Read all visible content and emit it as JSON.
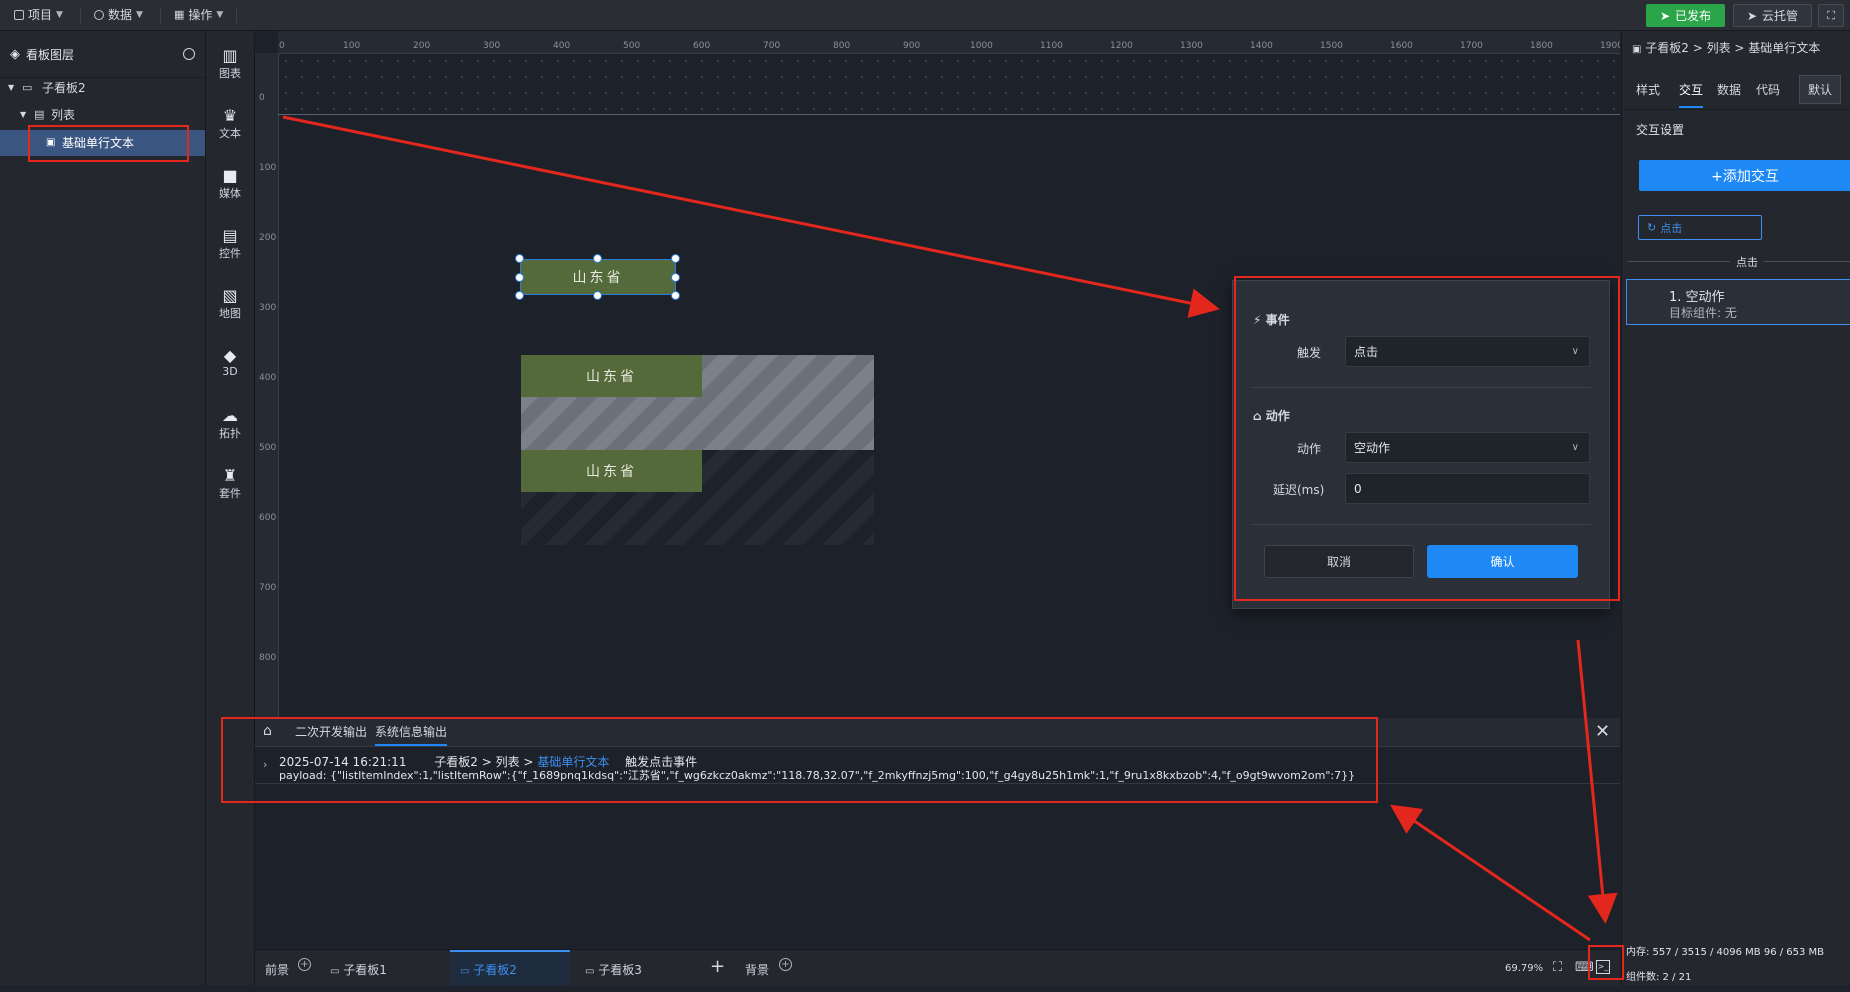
{
  "topbar": {
    "menus": [
      "项目",
      "数据",
      "操作"
    ],
    "published_label": "已发布",
    "cloud_label": "云托管"
  },
  "layers": {
    "title": "看板图层",
    "tree": [
      "子看板2",
      "列表",
      "基础单行文本"
    ]
  },
  "components": [
    "图表",
    "文本",
    "媒体",
    "控件",
    "地图",
    "3D",
    "拓扑",
    "套件"
  ],
  "ruler": {
    "top": [
      "0",
      "100",
      "200",
      "300",
      "400",
      "500",
      "600",
      "700",
      "800",
      "900",
      "1000",
      "1100",
      "1200",
      "1300",
      "1400",
      "1500",
      "1600",
      "1700",
      "1800",
      "1900"
    ],
    "left": [
      "0",
      "100",
      "200",
      "300",
      "400",
      "500",
      "600",
      "700",
      "800"
    ]
  },
  "canvas": {
    "text_value": "山东省"
  },
  "console": {
    "tabs": [
      "二次开发输出",
      "系统信息输出"
    ],
    "timestamp": "2025-07-14 16:21:11",
    "path_prefix": "子看板2 > 列表 >",
    "path_link": "基础单行文本",
    "event": "触发点击事件",
    "payload": "payload: {\"listItemIndex\":1,\"listItemRow\":{\"f_1689pnq1kdsq\":\"江苏省\",\"f_wg6zkcz0akmz\":\"118.78,32.07\",\"f_2mkyffnzj5mg\":100,\"f_g4gy8u25h1mk\":1,\"f_9ru1x8kxbzob\":4,\"f_o9gt9wvom2om\":7}}"
  },
  "bottombar": {
    "foreground": "前景",
    "tabs": [
      "子看板1",
      "子看板2",
      "子看板3"
    ],
    "background": "背景",
    "zoom": "69.79%",
    "memory": "内存:  557 / 3515 / 4096 MB  96 / 653 MB",
    "component_count": "组件数: 2 / 21"
  },
  "props": {
    "breadcrumb": "子看板2 > 列表 > 基础单行文本",
    "tabs": [
      "样式",
      "交互",
      "数据",
      "代码",
      "默认"
    ],
    "section_title": "交互设置",
    "add_button": "+添加交互",
    "trigger_chip": "点击",
    "divider_label": "点击",
    "action_title": "1. 空动作",
    "action_target": "目标组件: 无"
  },
  "dialog": {
    "event_section": "事件",
    "trigger_label": "触发",
    "trigger_value": "点击",
    "action_section": "动作",
    "action_label": "动作",
    "action_value": "空动作",
    "delay_label": "延迟(ms)",
    "delay_value": "0",
    "cancel_label": "取消",
    "confirm_label": "确认"
  },
  "colors": {
    "accent": "#1e88f5",
    "published": "#2aa549",
    "text_component": "#546a3a",
    "annotation": "#e3271c"
  }
}
